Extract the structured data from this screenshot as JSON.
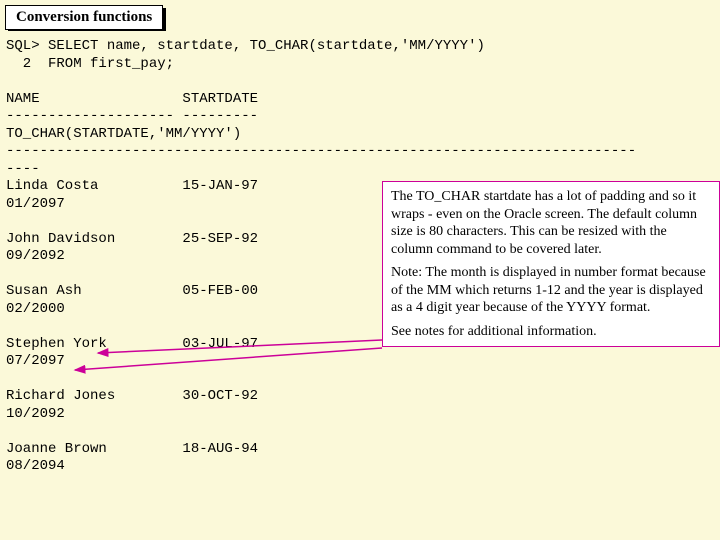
{
  "title": "Conversion functions",
  "sql": "SQL> SELECT name, startdate, TO_CHAR(startdate,'MM/YYYY')\n  2  FROM first_pay;\n\nNAME                 STARTDATE\n-------------------- ---------\nTO_CHAR(STARTDATE,'MM/YYYY')\n---------------------------------------------------------------------------\n----\nLinda Costa          15-JAN-97\n01/2097\n\nJohn Davidson        25-SEP-92\n09/2092\n\nSusan Ash            05-FEB-00\n02/2000\n\nStephen York         03-JUL-97\n07/2097\n\nRichard Jones        30-OCT-92\n10/2092\n\nJoanne Brown         18-AUG-94\n08/2094",
  "callout": {
    "p1": "The TO_CHAR startdate has a lot of padding and so it wraps - even on the Oracle screen.  The default column size is 80 characters.  This can be resized with the column command to be covered later.",
    "p2": "Note: The month is displayed in number format because of the MM which returns 1-12 and the year is displayed as a 4 digit year because of the YYYY format.",
    "p3": "See notes for additional information."
  }
}
